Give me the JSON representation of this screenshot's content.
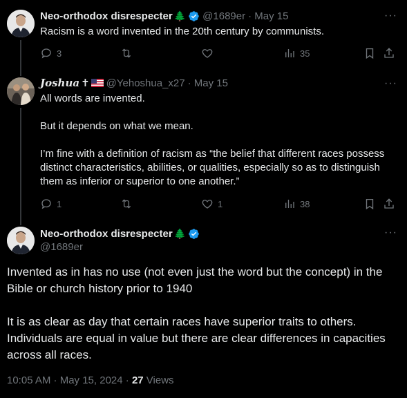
{
  "tweet1": {
    "name": "Neo-orthodox disrespecter",
    "tree_emoji": "🌲",
    "handle": "@1689er",
    "date": "· May 15",
    "text": "Racism is a word invented in the 20th century by communists.",
    "replies": "3",
    "retweets": "",
    "likes": "",
    "views": "35"
  },
  "tweet2": {
    "name": "Joshua",
    "cross_emoji": "✝",
    "handle": "@Yehoshua_x27",
    "date": "· May 15",
    "paragraphs": [
      "All words are invented.",
      "But it depends on what we mean.",
      "I’m fine with a definition of racism as “the belief that different races possess distinct characteristics, abilities, or qualities, especially so as to distinguish them as inferior or superior to one another.”"
    ],
    "replies": "1",
    "retweets": "",
    "likes": "1",
    "views": "38"
  },
  "main_tweet": {
    "name": "Neo-orthodox disrespecter",
    "tree_emoji": "🌲",
    "handle": "@1689er",
    "paragraphs": [
      "Invented as in has no use (not even just the word but the concept) in the Bible or church history prior to 1940",
      "It is as clear as day that certain races have superior traits to others. Individuals are equal in value but there are clear differences in capacities across all races."
    ],
    "timestamp": "10:05 AM · May 15, 2024 · ",
    "views_count": "27",
    "views_label": " Views"
  },
  "more_label": "···",
  "colors": {
    "background": "#000000",
    "text": "#e7e9ea",
    "muted": "#71767b",
    "verified": "#1d9bf0",
    "line": "#333639"
  }
}
